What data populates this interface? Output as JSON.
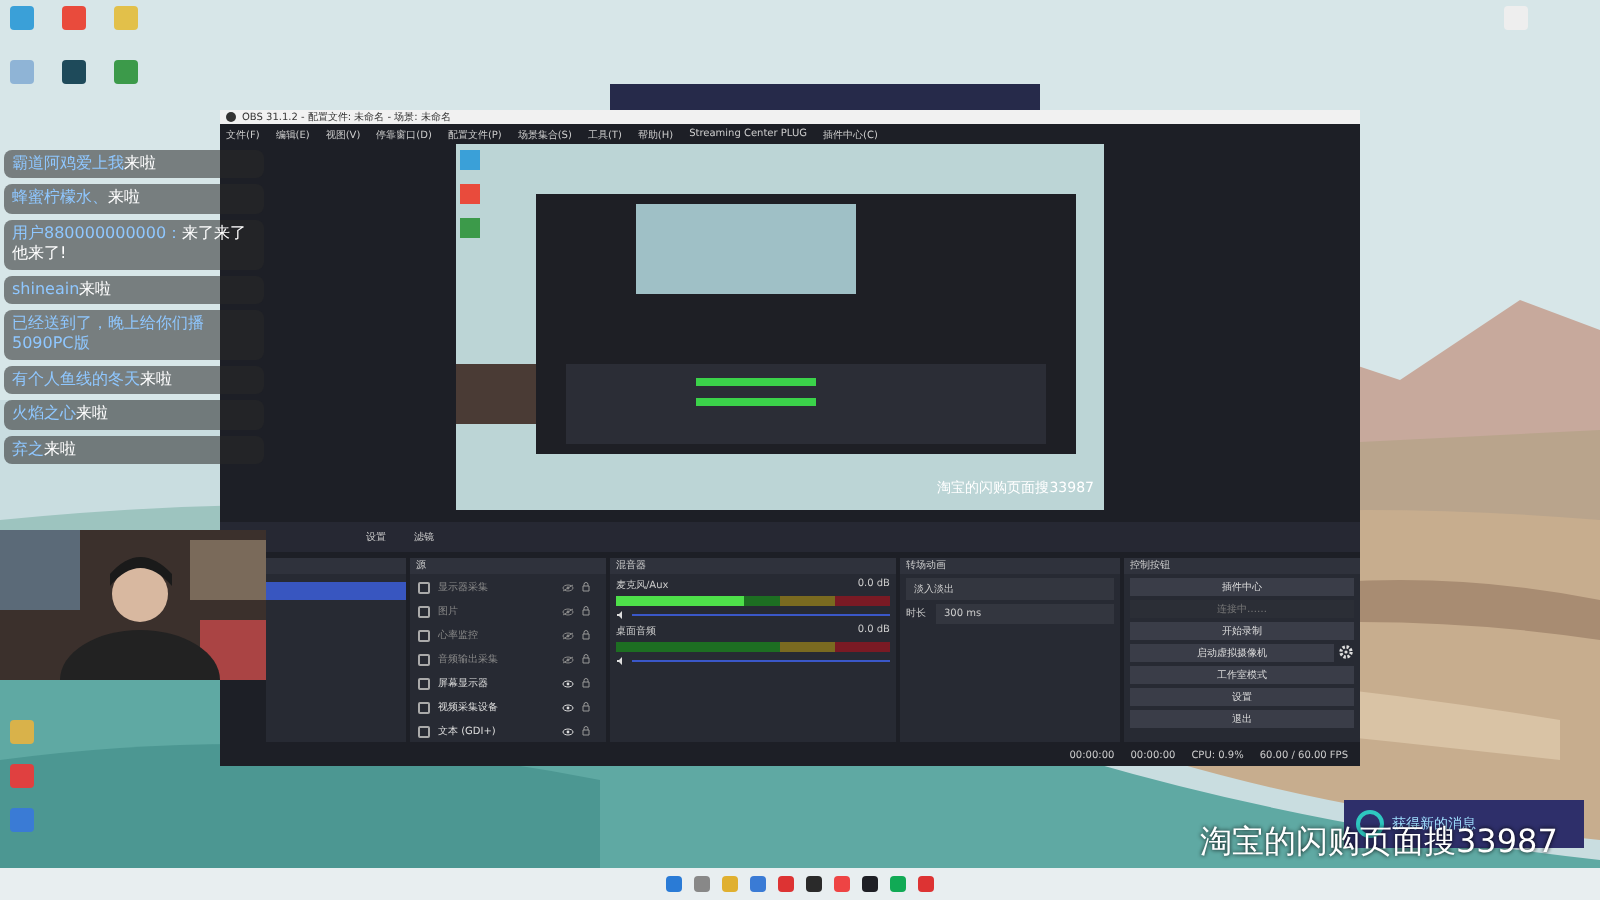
{
  "chat": [
    {
      "name": "霸道阿鸡爱上我",
      "message": "来啦"
    },
    {
      "name": "蜂蜜柠檬水、",
      "message": "来啦"
    },
    {
      "name": "用户880000000000：",
      "message": "来了来了他来了!"
    },
    {
      "name": "shineain",
      "message": "来啦"
    },
    {
      "name": "已经送到了，晚上给你们播5090PC版"
    },
    {
      "name": "有个人鱼线的冬天",
      "message": "来啦"
    },
    {
      "name": "火焰之心",
      "message": "来啦"
    },
    {
      "name": "弃之",
      "message": "来啦"
    }
  ],
  "obs": {
    "title": "OBS 31.1.2 - 配置文件: 未命名 - 场景: 未命名",
    "menu": [
      "文件(F)",
      "编辑(E)",
      "视图(V)",
      "停靠窗口(D)",
      "配置文件(P)",
      "场景集合(S)",
      "工具(T)",
      "帮助(H)",
      "Streaming Center PLUG",
      "插件中心(C)"
    ],
    "preview_text": "淘宝的闪购页面搜33987",
    "source_buttons": [
      "设置",
      "滤镜"
    ],
    "sources_title": "源",
    "sources": [
      {
        "name": "显示器采集",
        "visible": false
      },
      {
        "name": "图片",
        "visible": false
      },
      {
        "name": "心率监控",
        "visible": false
      },
      {
        "name": "音频输出采集",
        "visible": false
      },
      {
        "name": "屏幕显示器",
        "visible": true
      },
      {
        "name": "视频采集设备",
        "visible": true
      },
      {
        "name": "文本 (GDI+)",
        "visible": true
      }
    ],
    "mixer_title": "混音器",
    "channels": [
      {
        "name": "麦克风/Aux",
        "reading": "0.0 dB",
        "level": 0.47,
        "volume": {
          "level": 1
        }
      },
      {
        "name": "桌面音频",
        "reading": "0.0 dB",
        "level": 0,
        "volume": {
          "level": 1
        }
      }
    ],
    "transitions_title": "转场动画",
    "transition": "淡入淡出",
    "duration_label": "时长",
    "duration": "300 ms",
    "controls_title": "控制按钮",
    "controls": [
      {
        "label": "插件中心",
        "disabled": false
      },
      {
        "label": "连接中……",
        "disabled": true
      },
      {
        "label": "开始录制",
        "disabled": false
      },
      {
        "label": "启动虚拟摄像机",
        "disabled": false,
        "gear": true
      },
      {
        "label": "工作室模式",
        "disabled": false
      },
      {
        "label": "设置",
        "disabled": false
      },
      {
        "label": "退出",
        "disabled": false
      }
    ],
    "status": [
      "00:00:00",
      "00:00:00",
      "CPU: 0.9%",
      "60.00 / 60.00 FPS"
    ]
  },
  "notification": "获得新的消息",
  "overlay_lines": [
    "淘宝的闪购页面搜33987"
  ]
}
